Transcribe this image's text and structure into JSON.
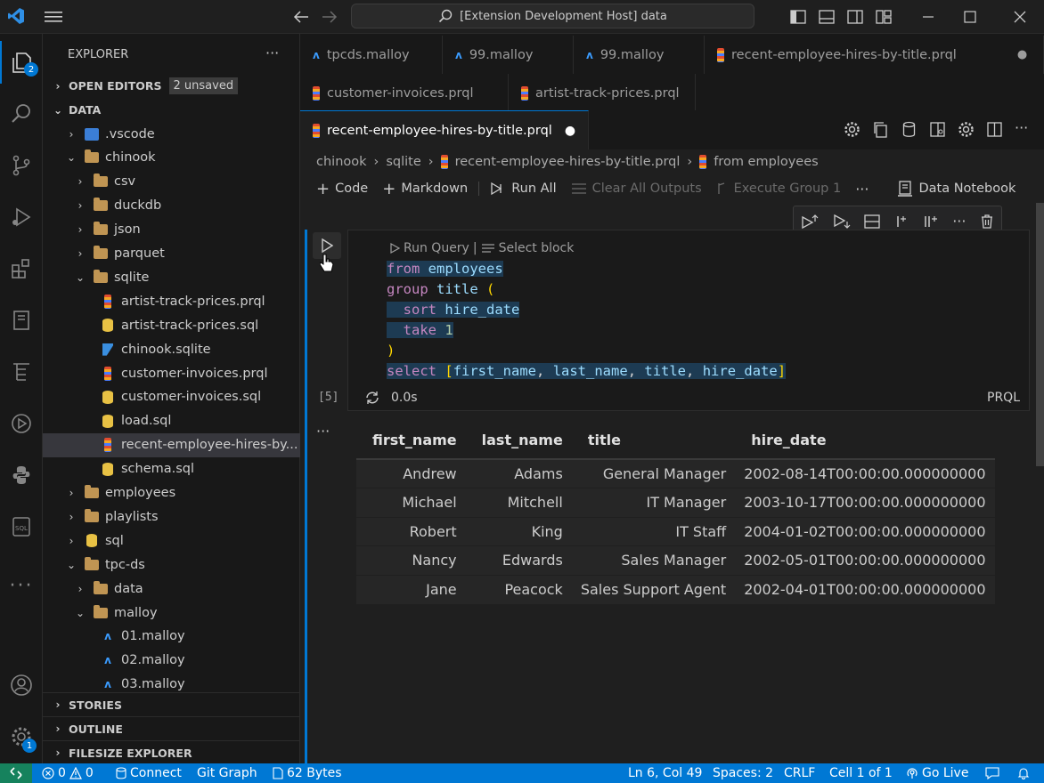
{
  "titlebar": {
    "search_text": "[Extension Development Host] data"
  },
  "activity": {
    "explorer_badge": "2",
    "settings_badge": "1"
  },
  "sidebar": {
    "title": "EXPLORER",
    "open_editors": "OPEN EDITORS",
    "unsaved_badge": "2 unsaved",
    "root": "DATA",
    "tree": [
      {
        "label": ".vscode",
        "type": "vsc",
        "level": 1,
        "chev": "›"
      },
      {
        "label": "chinook",
        "type": "folder",
        "level": 1,
        "chev": "⌄"
      },
      {
        "label": "csv",
        "type": "folder",
        "level": 2,
        "chev": "›"
      },
      {
        "label": "duckdb",
        "type": "folder",
        "level": 2,
        "chev": "›"
      },
      {
        "label": "json",
        "type": "folder",
        "level": 2,
        "chev": "›"
      },
      {
        "label": "parquet",
        "type": "folder",
        "level": 2,
        "chev": "›"
      },
      {
        "label": "sqlite",
        "type": "folder",
        "level": 2,
        "chev": "⌄"
      },
      {
        "label": "artist-track-prices.prql",
        "type": "prql",
        "level": 3
      },
      {
        "label": "artist-track-prices.sql",
        "type": "db",
        "level": 3
      },
      {
        "label": "chinook.sqlite",
        "type": "sqlite",
        "level": 3
      },
      {
        "label": "customer-invoices.prql",
        "type": "prql",
        "level": 3
      },
      {
        "label": "customer-invoices.sql",
        "type": "db",
        "level": 3
      },
      {
        "label": "load.sql",
        "type": "db",
        "level": 3
      },
      {
        "label": "recent-employee-hires-by...",
        "type": "prql",
        "level": 3,
        "selected": true
      },
      {
        "label": "schema.sql",
        "type": "db",
        "level": 3
      },
      {
        "label": "employees",
        "type": "folder",
        "level": 1,
        "chev": "›"
      },
      {
        "label": "playlists",
        "type": "folder",
        "level": 1,
        "chev": "›"
      },
      {
        "label": "sql",
        "type": "db",
        "level": 1,
        "chev": "›"
      },
      {
        "label": "tpc-ds",
        "type": "folder",
        "level": 1,
        "chev": "⌄"
      },
      {
        "label": "data",
        "type": "folder",
        "level": 2,
        "chev": "›"
      },
      {
        "label": "malloy",
        "type": "folder",
        "level": 2,
        "chev": "⌄"
      },
      {
        "label": "01.malloy",
        "type": "malloy",
        "level": 3
      },
      {
        "label": "02.malloy",
        "type": "malloy",
        "level": 3
      },
      {
        "label": "03.malloy",
        "type": "malloy",
        "level": 3
      }
    ],
    "stories": "STORIES",
    "outline": "OUTLINE",
    "filesize": "FILESIZE EXPLORER"
  },
  "tabs": {
    "row1": [
      {
        "label": "tpcds.malloy",
        "type": "malloy"
      },
      {
        "label": "99.malloy",
        "type": "malloy"
      },
      {
        "label": "99.malloy",
        "type": "malloy"
      },
      {
        "label": "recent-employee-hires-by-title.prql",
        "type": "prql"
      }
    ],
    "row2": [
      {
        "label": "customer-invoices.prql",
        "type": "prql"
      },
      {
        "label": "artist-track-prices.prql",
        "type": "prql"
      }
    ],
    "active": "recent-employee-hires-by-title.prql"
  },
  "breadcrumbs": [
    "chinook",
    "sqlite",
    "recent-employee-hires-by-title.prql",
    "from employees"
  ],
  "toolbar": {
    "code": "Code",
    "markdown": "Markdown",
    "run_all": "Run All",
    "clear_outputs": "Clear All Outputs",
    "execute_group": "Execute Group 1",
    "data_notebook": "Data Notebook"
  },
  "cell": {
    "codelens_run": "Run Query",
    "codelens_select": "Select block",
    "exec_count": "[5]",
    "time": "0.0s",
    "language": "PRQL"
  },
  "output": {
    "columns": [
      "first_name",
      "last_name",
      "title",
      "hire_date"
    ],
    "rows": [
      [
        "Andrew",
        "Adams",
        "General Manager",
        "2002-08-14T00:00:00.000000000"
      ],
      [
        "Michael",
        "Mitchell",
        "IT Manager",
        "2003-10-17T00:00:00.000000000"
      ],
      [
        "Robert",
        "King",
        "IT Staff",
        "2004-01-02T00:00:00.000000000"
      ],
      [
        "Nancy",
        "Edwards",
        "Sales Manager",
        "2002-05-01T00:00:00.000000000"
      ],
      [
        "Jane",
        "Peacock",
        "Sales Support Agent",
        "2002-04-01T00:00:00.000000000"
      ]
    ]
  },
  "status": {
    "errors": "0",
    "warnings": "0",
    "connect": "Connect",
    "git_graph": "Git Graph",
    "size": "62 Bytes",
    "position": "Ln 6, Col 49",
    "spaces": "Spaces: 2",
    "eol": "CRLF",
    "cell": "Cell 1 of 1",
    "go_live": "Go Live"
  },
  "colors": {
    "accent": "#0078d4",
    "background": "#1f1f1f"
  }
}
